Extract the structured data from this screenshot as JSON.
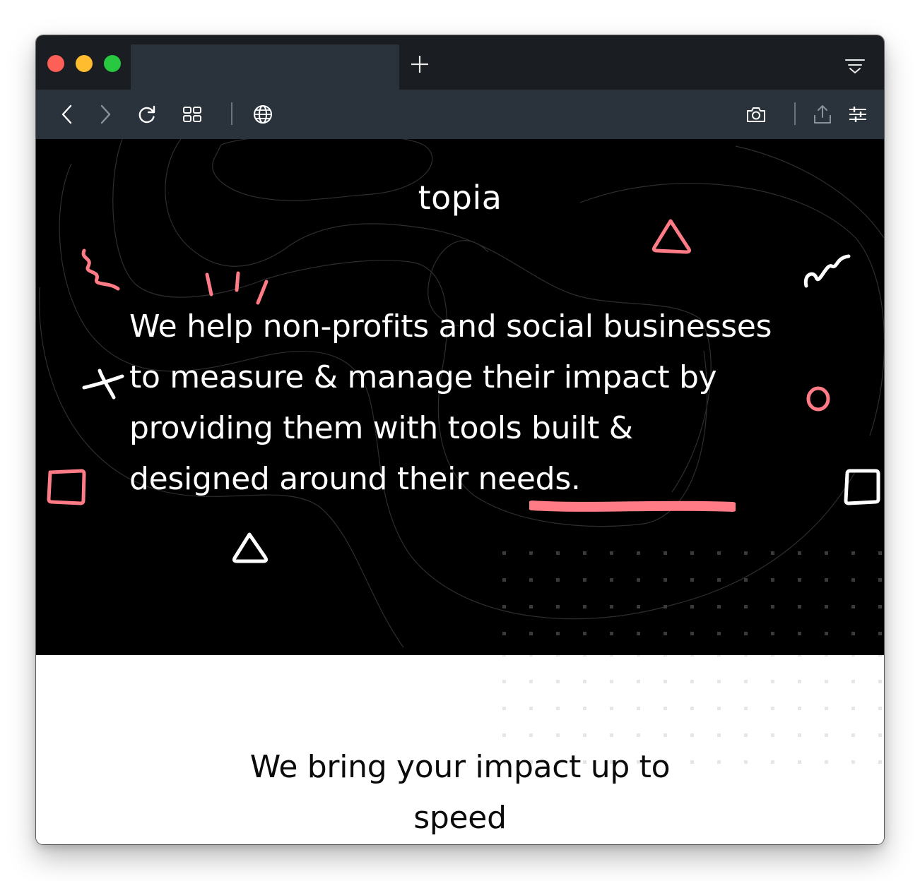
{
  "browser": {
    "window_controls": [
      "close-button",
      "minimize-button",
      "maximize-button"
    ],
    "new_tab_label": "+",
    "icons": {
      "back": "chevron-left-icon",
      "forward": "chevron-right-icon",
      "reload": "reload-icon",
      "speed_dial": "grid-icon",
      "site_info": "globe-icon",
      "snapshot": "camera-icon",
      "share": "share-icon",
      "easy_setup": "sliders-icon",
      "tab_menu": "tab-list-icon"
    }
  },
  "page": {
    "logo_text": "topia",
    "hero_text": "We help non-profits and social businesses to measure & manage their impact by providing them with tools built & designed around their needs.",
    "section_title": "We bring your impact up to speed"
  },
  "colors": {
    "hero_background": "#000000",
    "accent_pink": "#ff7b85",
    "doodle_white": "#ffffff",
    "toolbar": "#2a323c",
    "titlebar": "#1a1d21"
  }
}
